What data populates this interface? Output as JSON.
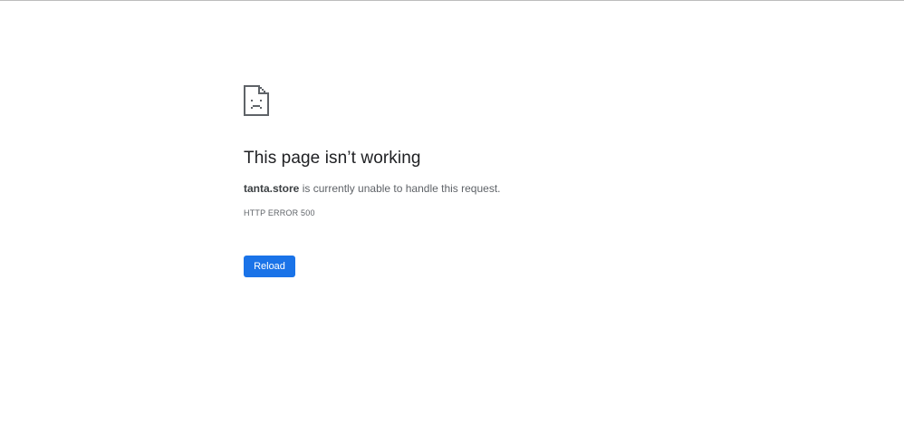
{
  "error": {
    "icon": "sad-page-icon",
    "title": "This page isn’t working",
    "host": "tanta.store",
    "description_rest": " is currently unable to handle this request.",
    "code": "HTTP ERROR 500",
    "reload_label": "Reload"
  },
  "colors": {
    "button_bg": "#1a73e8",
    "title_text": "#202124",
    "body_text": "#5f6368",
    "icon": "#5f6368"
  }
}
